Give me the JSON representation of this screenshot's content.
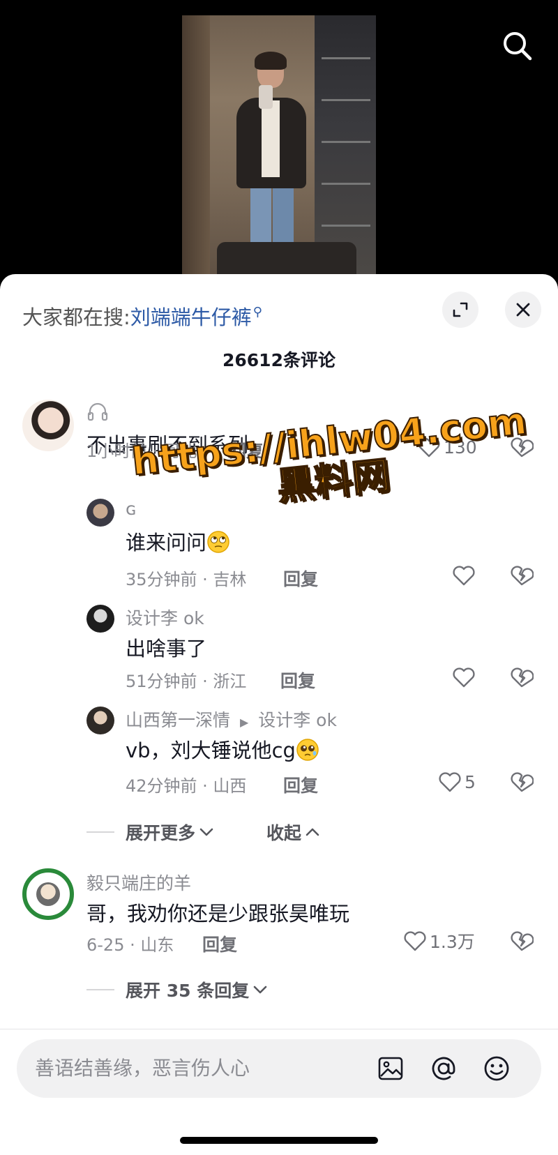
{
  "hot_search": {
    "prefix": "大家都在搜:",
    "term": "刘端端牛仔裤"
  },
  "comment_count": "26612条评论",
  "comments": [
    {
      "username": "",
      "text": "不出事刷不到系列",
      "time": "1小时前 · 河北",
      "reply_label": "回复",
      "likes": "130"
    },
    {
      "username": "ɢ",
      "text": "谁来问问",
      "time": "35分钟前 · 吉林",
      "reply_label": "回复",
      "likes": ""
    },
    {
      "username": "设计李 ok",
      "text": "出啥事了",
      "time": "51分钟前 · 浙江",
      "reply_label": "回复",
      "likes": ""
    },
    {
      "username": "山西第一深情",
      "reply_to": "设计李 ok",
      "text": "vb，刘大锤说他cg",
      "time": "42分钟前 · 山西",
      "reply_label": "回复",
      "likes": "5"
    },
    {
      "username": "毅只端庄的羊",
      "text": "哥，我劝你还是少跟张昊唯玩",
      "time": "6-25 · 山东",
      "reply_label": "回复",
      "likes": "1.3万"
    }
  ],
  "expand_more": "展开更多",
  "collapse": "收起",
  "expand_replies": "展开 35 条回复",
  "watermark": {
    "line1": "https://ihlw04.com",
    "line2": "黑料网"
  },
  "input": {
    "placeholder": "善语结善缘，恶言伤人心"
  },
  "colors": {
    "link_blue": "#2d5aa6",
    "watermark_orange": "#f7a21b",
    "sheet_bg": "#ffffff"
  }
}
